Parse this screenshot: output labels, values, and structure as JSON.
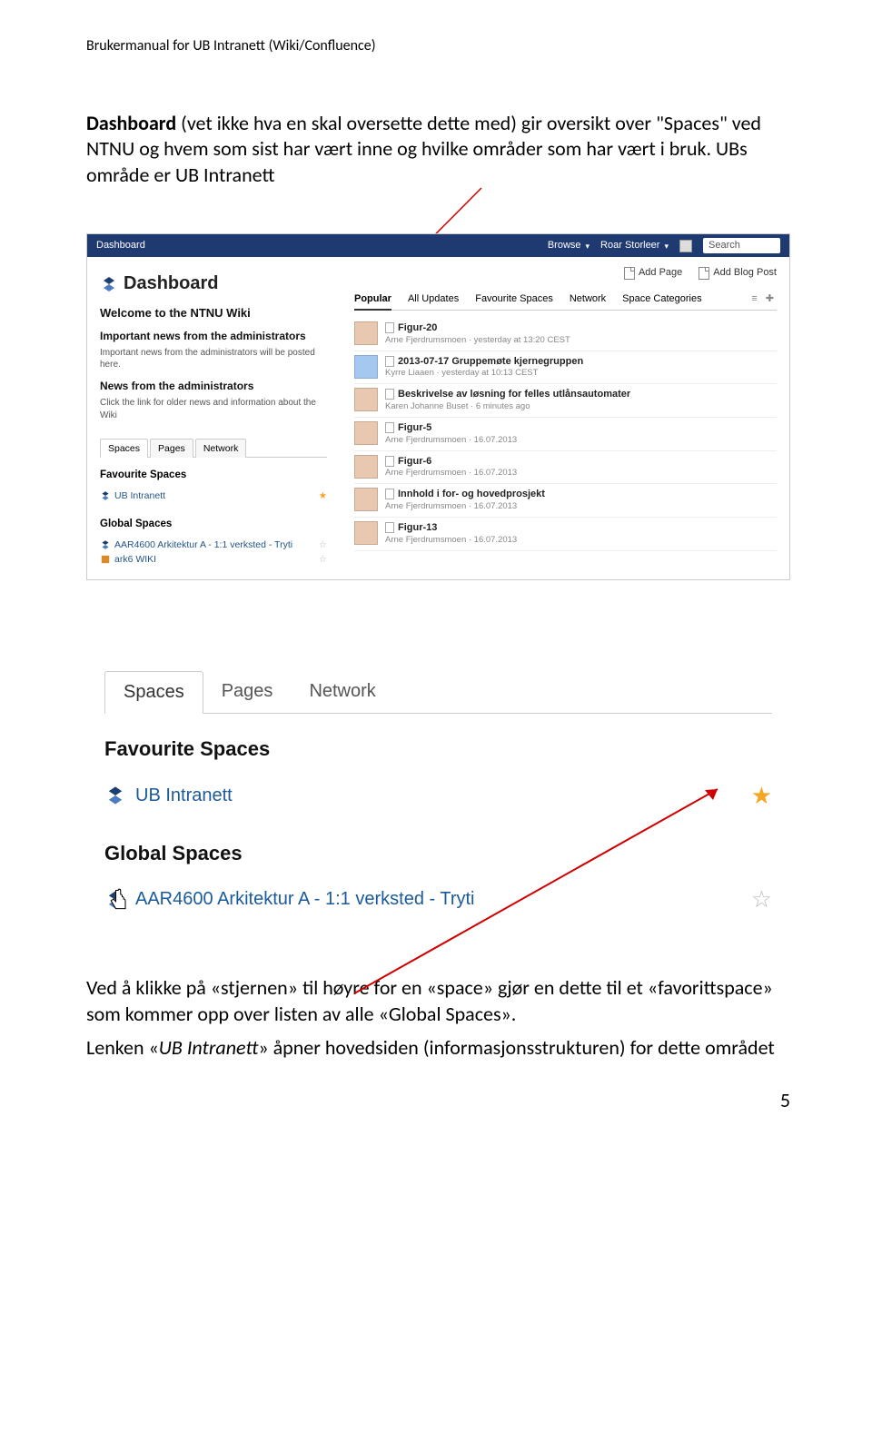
{
  "doc_header": "Brukermanual for UB Intranett (Wiki/Confluence)",
  "intro": {
    "bold": "Dashboard",
    "rest_line1": "  (vet ikke hva en skal oversette dette med) gir oversikt over \"Spaces\" ved NTNU og hvem som sist har vært inne og hvilke områder som har vært i bruk. UBs område er UB Intranett"
  },
  "topbar": {
    "dashboard": "Dashboard",
    "browse": "Browse",
    "user": "Roar Storleer",
    "search": "Search"
  },
  "shot1": {
    "dash_title": "Dashboard",
    "welcome": "Welcome to the NTNU Wiki",
    "imp_head": "Important news from the administrators",
    "imp_body": "Important news from the administrators will be posted here.",
    "news_head": "News from the administrators",
    "news_body": "Click the link for older news and information about the Wiki",
    "ltabs": [
      "Spaces",
      "Pages",
      "Network"
    ],
    "fav_head": "Favourite Spaces",
    "fav_item": "UB Intranett",
    "global_head": "Global Spaces",
    "global_items": [
      "AAR4600 Arkitektur A - 1:1 verksted - Tryti",
      "ark6 WIKI"
    ],
    "actions": {
      "add_page": "Add Page",
      "add_blog": "Add Blog Post"
    },
    "rtabs": [
      "Popular",
      "All Updates",
      "Favourite Spaces",
      "Network",
      "Space Categories"
    ],
    "feed": [
      {
        "avatar": "face",
        "title": "Figur-20",
        "meta": "Arne Fjerdrumsmoen · yesterday at 13:20 CEST"
      },
      {
        "avatar": "blue",
        "title": "2013-07-17 Gruppemøte kjernegruppen",
        "meta": "Kyrre Liaaen · yesterday at 10:13 CEST"
      },
      {
        "avatar": "face",
        "title": "Beskrivelse av løsning for felles utlånsautomater",
        "meta": "Karen Johanne Buset · 6 minutes ago"
      },
      {
        "avatar": "face",
        "title": "Figur-5",
        "meta": "Arne Fjerdrumsmoen · 16.07.2013"
      },
      {
        "avatar": "face",
        "title": "Figur-6",
        "meta": "Arne Fjerdrumsmoen · 16.07.2013"
      },
      {
        "avatar": "face",
        "title": "Innhold i for- og hovedprosjekt",
        "meta": "Arne Fjerdrumsmoen · 16.07.2013"
      },
      {
        "avatar": "face",
        "title": "Figur-13",
        "meta": "Arne Fjerdrumsmoen · 16.07.2013"
      }
    ]
  },
  "shot2": {
    "tabs": [
      "Spaces",
      "Pages",
      "Network"
    ],
    "fav_head": "Favourite Spaces",
    "fav_item": "UB Intranett",
    "global_head": "Global Spaces",
    "global_item": "AAR4600 Arkitektur A - 1:1 verksted - Tryti"
  },
  "outro": {
    "p1": "Ved å klikke på «stjernen» til høyre for en «space» gjør en dette til et «favorittspace»  som kommer opp over listen av alle «Global Spaces».",
    "p2a": "Lenken «",
    "p2_italic": "UB Intranett",
    "p2b": "» åpner hovedsiden (informasjonsstrukturen) for dette området"
  },
  "page_number": "5"
}
